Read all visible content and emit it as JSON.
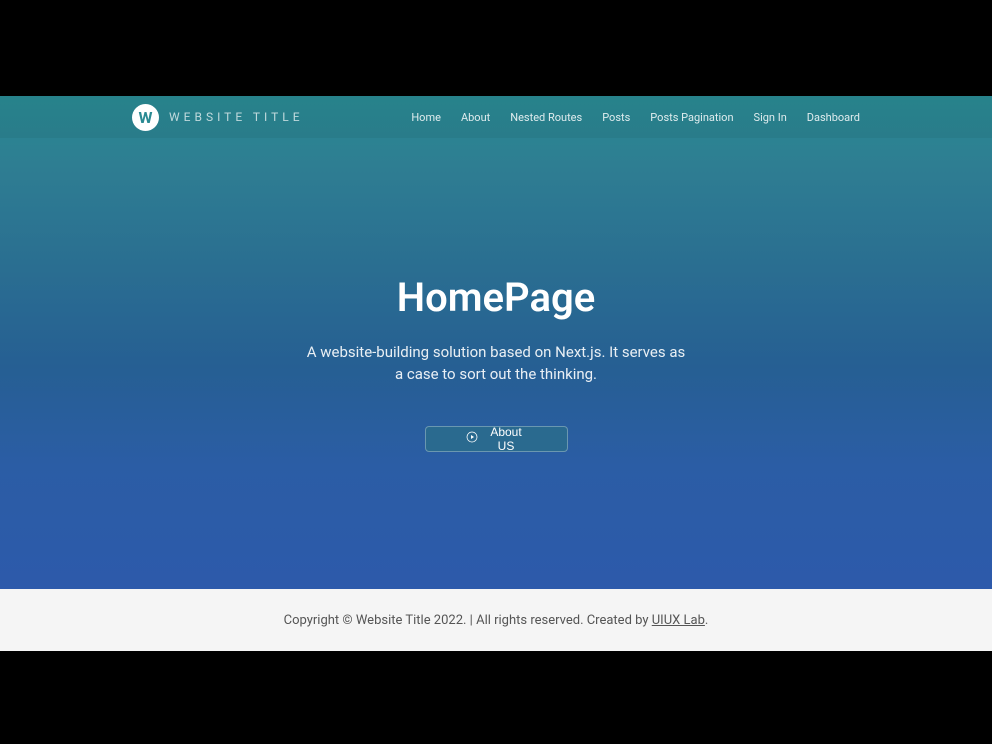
{
  "brand": {
    "logo_letter": "W",
    "name": "WEBSITE TITLE"
  },
  "nav": {
    "items": [
      {
        "label": "Home"
      },
      {
        "label": "About"
      },
      {
        "label": "Nested Routes"
      },
      {
        "label": "Posts"
      },
      {
        "label": "Posts Pagination"
      },
      {
        "label": "Sign In"
      },
      {
        "label": "Dashboard"
      }
    ]
  },
  "hero": {
    "title": "HomePage",
    "description": "A website-building solution based on Next.js. It serves as a case to sort out the thinking.",
    "cta_label": "About US"
  },
  "footer": {
    "copyright_prefix": "Copyright © Website Title 2022. | All rights reserved. Created by ",
    "link_text": "UIUX Lab",
    "suffix": "."
  }
}
